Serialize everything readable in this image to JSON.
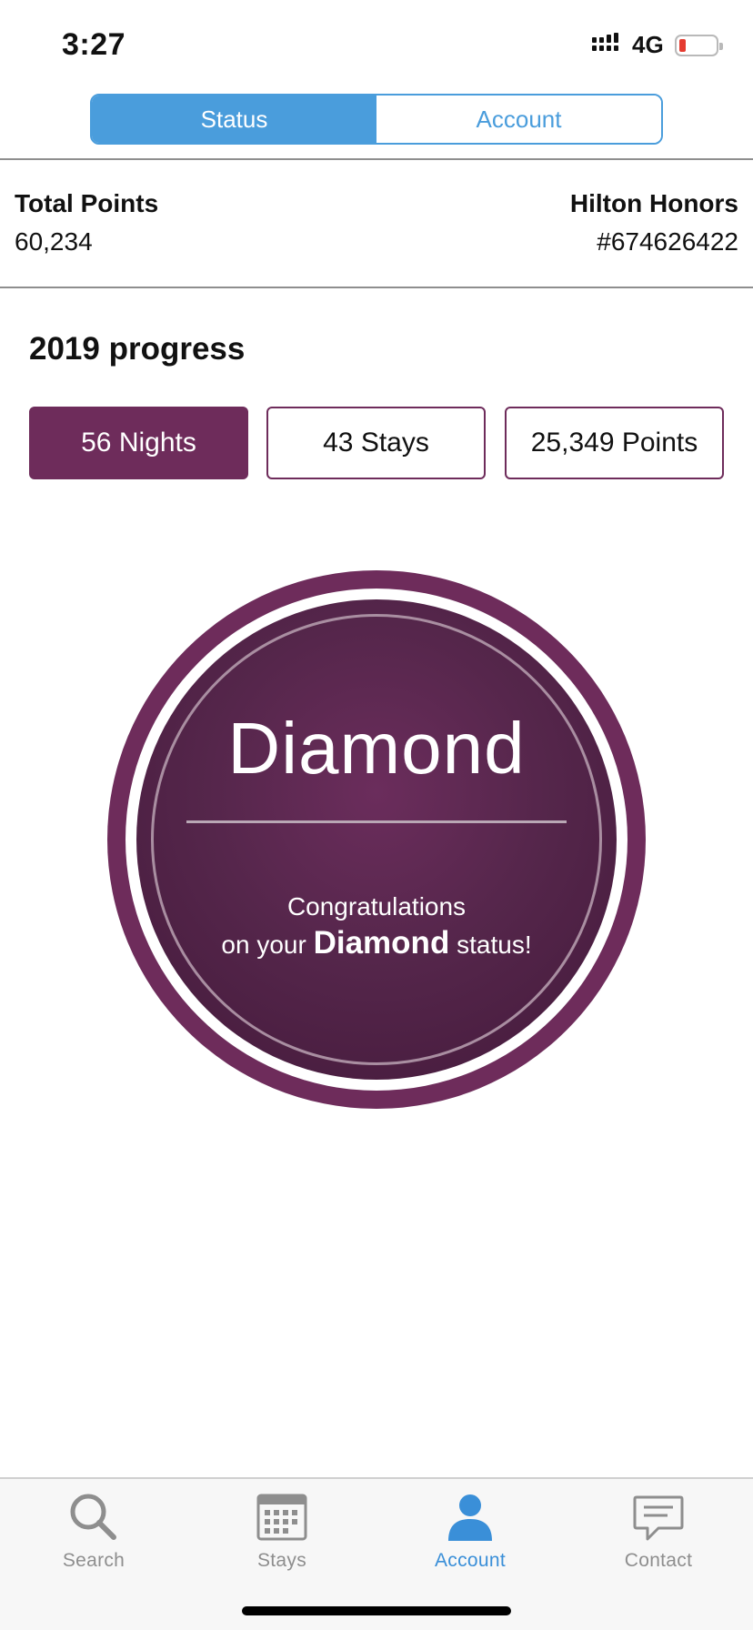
{
  "status_bar": {
    "time": "3:27",
    "network": "4G",
    "battery_icon": "battery-low-icon",
    "signal_icon": "signal-icon"
  },
  "segmented": {
    "tabs": [
      "Status",
      "Account"
    ],
    "selected": "Status",
    "accent": "#4a9ddc"
  },
  "summary": {
    "total_points_label": "Total Points",
    "total_points_value": "60,234",
    "honors_label": "Hilton Honors",
    "honors_number": "#674626422"
  },
  "progress": {
    "title": "2019 progress",
    "tabs": [
      "56 Nights",
      "43 Stays",
      "25,349 Points"
    ],
    "selected": "56 Nights",
    "brand_color": "#6e2c5b"
  },
  "badge": {
    "tier": "Diamond",
    "congrats_line1": "Congratulations",
    "congrats_prefix": "on your",
    "congrats_bold": "Diamond",
    "congrats_suffix": "status!"
  },
  "tabbar": {
    "items": [
      {
        "label": "Search",
        "icon": "search-icon"
      },
      {
        "label": "Stays",
        "icon": "calendar-icon"
      },
      {
        "label": "Account",
        "icon": "person-icon"
      },
      {
        "label": "Contact",
        "icon": "chat-icon"
      }
    ],
    "selected": "Account",
    "active_color": "#3a8fd8"
  }
}
